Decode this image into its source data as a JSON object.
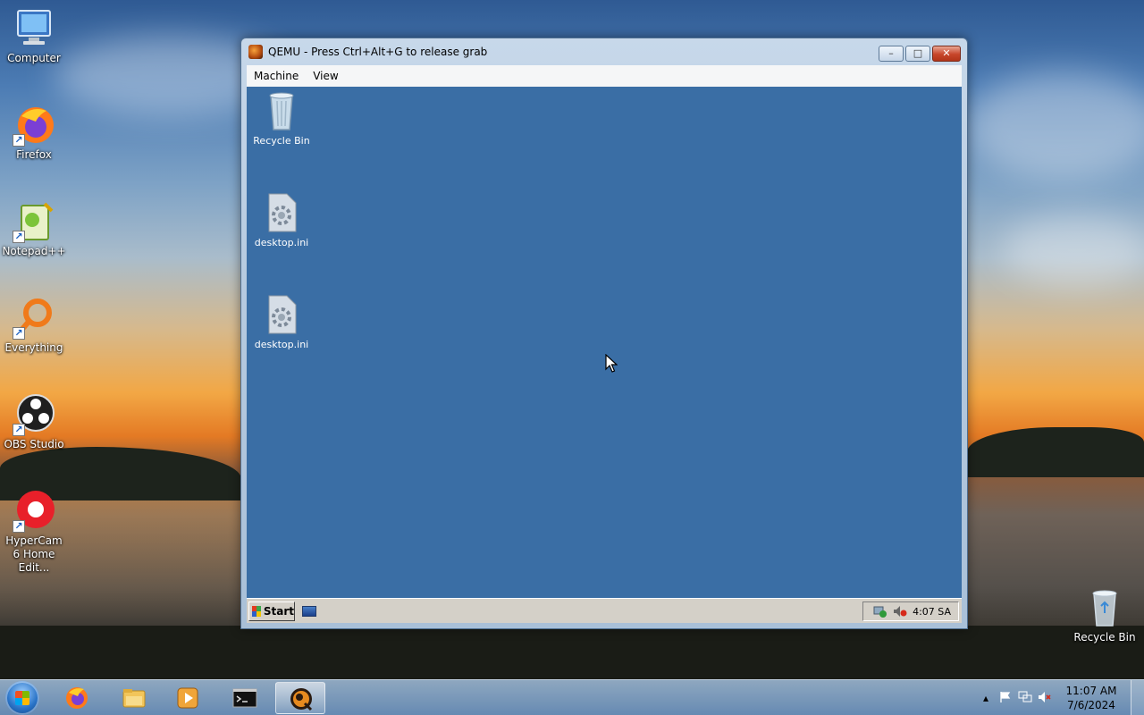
{
  "host_desktop": {
    "icons": [
      {
        "label": "Computer"
      },
      {
        "label": "Firefox"
      },
      {
        "label": "Notepad++"
      },
      {
        "label": "Everything"
      },
      {
        "label": "OBS Studio"
      },
      {
        "label": "HyperCam 6 Home Edit..."
      },
      {
        "label": "Recycle Bin"
      }
    ]
  },
  "qemu_window": {
    "title": "QEMU - Press Ctrl+Alt+G to release grab",
    "menu": [
      "Machine",
      "View"
    ],
    "buttons": {
      "minimize": "–",
      "maximize": "□",
      "close": "✕"
    }
  },
  "guest": {
    "icons": [
      {
        "label": "Recycle Bin"
      },
      {
        "label": "desktop.ini"
      },
      {
        "label": "desktop.ini"
      }
    ],
    "start_label": "Start",
    "tray_time": "4:07 SA"
  },
  "host_taskbar": {
    "clock_time": "11:07 AM",
    "clock_date": "7/6/2024",
    "pinned": [
      "firefox",
      "file-explorer",
      "media-player",
      "cmd",
      "qemu"
    ],
    "active_index": 4
  },
  "colors": {
    "guest_background": "#3a6ea5",
    "guest_taskbar": "#d4d0c8"
  }
}
